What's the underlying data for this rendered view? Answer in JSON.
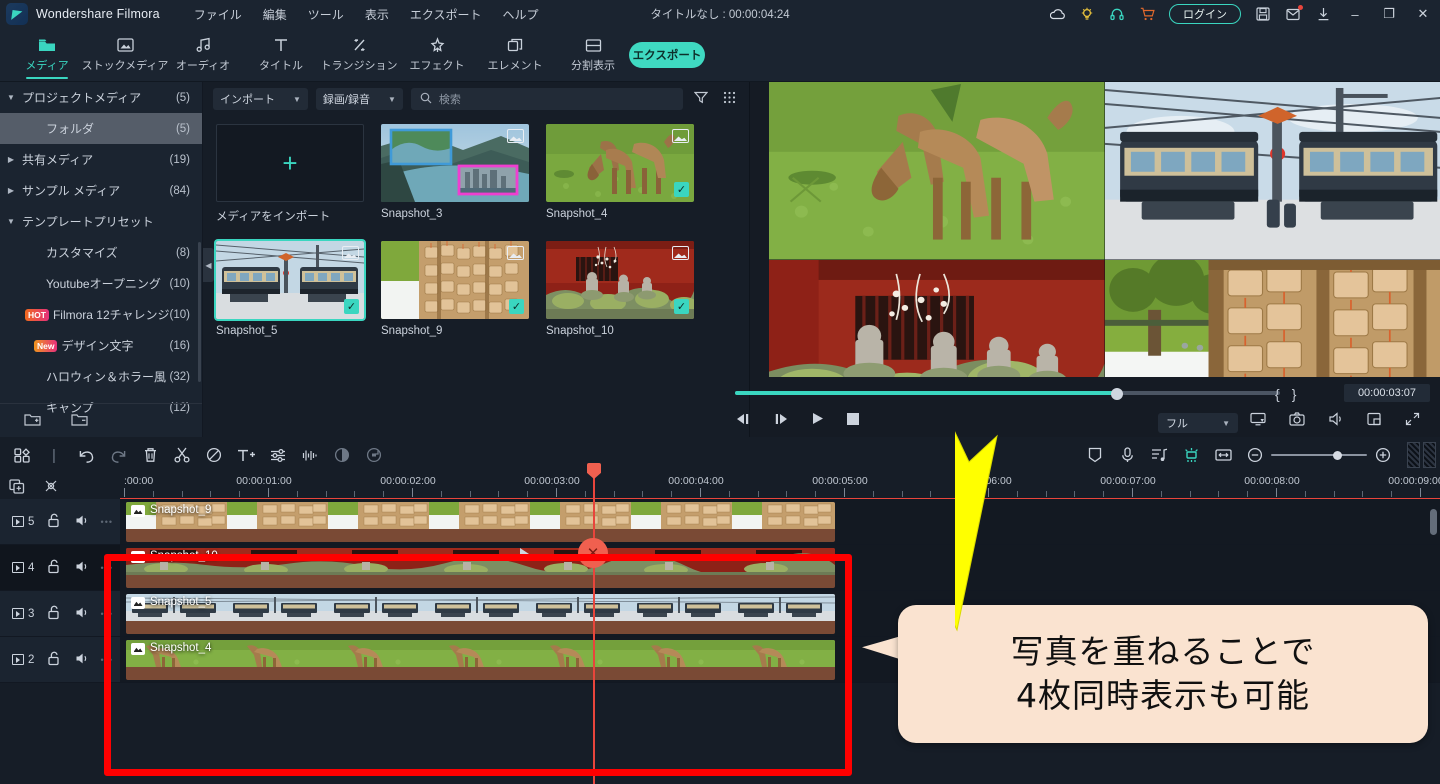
{
  "app": {
    "name": "Wondershare Filmora",
    "logo_icon": "filmora-logo-icon",
    "doc_title": "タイトルなし : 00:00:04:24"
  },
  "menu": [
    "ファイル",
    "編集",
    "ツール",
    "表示",
    "エクスポート",
    "ヘルプ"
  ],
  "titlebar_icons": [
    {
      "name": "cloud-icon",
      "glyph": "☁",
      "color": "#d8dee6"
    },
    {
      "name": "lightbulb-icon",
      "glyph": "💡",
      "color": "#e7c13c"
    },
    {
      "name": "headset-icon",
      "glyph": "🎧",
      "color": "#3ad6c0"
    },
    {
      "name": "cart-icon",
      "glyph": "🛒",
      "color": "#e2692c"
    }
  ],
  "login_label": "ログイン",
  "window_icons": [
    {
      "name": "save-icon",
      "glyph": "▤"
    },
    {
      "name": "mail-icon",
      "glyph": "✉"
    },
    {
      "name": "download-icon",
      "glyph": "⤓"
    }
  ],
  "window_controls": [
    "–",
    "❐",
    "✕"
  ],
  "navtabs": [
    {
      "label": "メディア",
      "icon": "folder-icon",
      "glyph": "▬",
      "active": true
    },
    {
      "label": "ストックメディア",
      "icon": "stock-media-icon",
      "glyph": "▣",
      "active": false
    },
    {
      "label": "オーディオ",
      "icon": "audio-note-icon",
      "glyph": "♬",
      "active": false
    },
    {
      "label": "タイトル",
      "icon": "title-text-icon",
      "glyph": "T",
      "active": false
    },
    {
      "label": "トランジション",
      "icon": "transition-icon",
      "glyph": "⇄",
      "active": false
    },
    {
      "label": "エフェクト",
      "icon": "effect-icon",
      "glyph": "✧",
      "active": false
    },
    {
      "label": "エレメント",
      "icon": "element-icon",
      "glyph": "❐",
      "active": false
    },
    {
      "label": "分割表示",
      "icon": "split-screen-icon",
      "glyph": "▤",
      "active": false
    }
  ],
  "export_label": "エクスポート",
  "sidebar": {
    "items": [
      {
        "label": "プロジェクトメディア",
        "count": "(5)",
        "arrow": "▼",
        "indent": 0,
        "selected": false,
        "tag": ""
      },
      {
        "label": "フォルダ",
        "count": "(5)",
        "arrow": "",
        "indent": 1,
        "selected": true,
        "tag": ""
      },
      {
        "label": "共有メディア",
        "count": "(19)",
        "arrow": "▶",
        "indent": 0,
        "selected": false,
        "tag": ""
      },
      {
        "label": "サンプル メディア",
        "count": "(84)",
        "arrow": "▶",
        "indent": 0,
        "selected": false,
        "tag": ""
      },
      {
        "label": "テンプレートプリセット",
        "count": "",
        "arrow": "▼",
        "indent": 0,
        "selected": false,
        "tag": ""
      },
      {
        "label": "カスタマイズ",
        "count": "(8)",
        "arrow": "",
        "indent": 1,
        "selected": false,
        "tag": ""
      },
      {
        "label": "Youtubeオープニング",
        "count": "(10)",
        "arrow": "",
        "indent": 1,
        "selected": false,
        "tag": ""
      },
      {
        "label": "Filmora 12チャレンジ",
        "count": "(10)",
        "arrow": "",
        "indent": 1,
        "selected": false,
        "tag": "HOT"
      },
      {
        "label": "デザイン文字",
        "count": "(16)",
        "arrow": "",
        "indent": 1,
        "selected": false,
        "tag": "New"
      },
      {
        "label": "ハロウィン＆ホラー風",
        "count": "(32)",
        "arrow": "",
        "indent": 1,
        "selected": false,
        "tag": ""
      },
      {
        "label": "キャンプ",
        "count": "(12)",
        "arrow": "",
        "indent": 1,
        "selected": false,
        "tag": ""
      }
    ],
    "footer_icons": [
      {
        "name": "new-folder-icon",
        "glyph": "🗀"
      },
      {
        "name": "remove-folder-icon",
        "glyph": "🗁"
      }
    ]
  },
  "media_panel": {
    "import_label": "インポート",
    "record_label": "録画/録音",
    "search_placeholder": "検索",
    "filter_icon": "filter-icon",
    "view_icon": "grid-view-icon",
    "import_tile_label": "メディアをインポート",
    "items": [
      {
        "label": "Snapshot_3",
        "checked": false,
        "selected": false
      },
      {
        "label": "Snapshot_4",
        "checked": true,
        "selected": false
      },
      {
        "label": "Snapshot_5",
        "checked": true,
        "selected": true
      },
      {
        "label": "Snapshot_9",
        "checked": true,
        "selected": false
      },
      {
        "label": "Snapshot_10",
        "checked": true,
        "selected": false
      }
    ]
  },
  "preview": {
    "timecode": "00:00:03:07",
    "mark_in": "{",
    "mark_out": "}",
    "quality_label": "フル",
    "progress_percent": 70,
    "transport": [
      {
        "name": "prev-frame-button",
        "glyph": "◀|"
      },
      {
        "name": "next-frame-button",
        "glyph": "|▶"
      },
      {
        "name": "play-button",
        "glyph": "▶"
      },
      {
        "name": "stop-button",
        "glyph": "■"
      }
    ],
    "right_icons": [
      {
        "name": "screen-cast-icon",
        "glyph": "🖵"
      },
      {
        "name": "snapshot-camera-icon",
        "glyph": "📷"
      },
      {
        "name": "volume-icon",
        "glyph": "🔊"
      },
      {
        "name": "pip-icon",
        "glyph": "❐"
      },
      {
        "name": "fullscreen-icon",
        "glyph": "⤢"
      }
    ]
  },
  "timeline": {
    "tools_left": [
      {
        "name": "layout-grid-icon",
        "glyph": "⠿",
        "state": "normal"
      },
      {
        "name": "divider",
        "glyph": "|",
        "state": "dim"
      },
      {
        "name": "undo-icon",
        "glyph": "↺",
        "state": "normal"
      },
      {
        "name": "redo-icon",
        "glyph": "↻",
        "state": "dim"
      },
      {
        "name": "delete-icon",
        "glyph": "🗑",
        "state": "normal"
      },
      {
        "name": "cut-scissors-icon",
        "glyph": "✂",
        "state": "normal"
      },
      {
        "name": "disable-icon",
        "glyph": "⊘",
        "state": "normal"
      },
      {
        "name": "add-text-icon",
        "glyph": "T+",
        "state": "normal"
      },
      {
        "name": "adjust-sliders-icon",
        "glyph": "⇌",
        "state": "normal"
      },
      {
        "name": "audio-wave-icon",
        "glyph": "⑊",
        "state": "normal"
      },
      {
        "name": "color-match-icon",
        "glyph": "◑",
        "state": "dim"
      },
      {
        "name": "speed-icon",
        "glyph": "⟳",
        "state": "dim"
      }
    ],
    "tools_right": [
      {
        "name": "marker-icon",
        "glyph": "⌂",
        "state": "normal"
      },
      {
        "name": "voiceover-mic-icon",
        "glyph": "🎤",
        "state": "normal"
      },
      {
        "name": "beat-detect-icon",
        "glyph": "♪",
        "state": "normal"
      },
      {
        "name": "render-preview-icon",
        "glyph": "✳",
        "state": "green"
      },
      {
        "name": "fit-timeline-icon",
        "glyph": "↔",
        "state": "normal"
      },
      {
        "name": "zoom-out-icon",
        "glyph": "⊖",
        "state": "normal"
      }
    ],
    "zoom_in_icon": "zoom-in-icon",
    "row2_icons": [
      {
        "name": "add-track-icon",
        "glyph": "⎘"
      },
      {
        "name": "unlink-icon",
        "glyph": "⚯"
      }
    ],
    "ruler_labels": [
      ":00:00",
      "00:00:01:00",
      "00:00:02:00",
      "00:00:03:00",
      "00:00:04:00",
      "00:00:05:00",
      "00:00:06:00",
      "00:00:07:00",
      "00:00:08:00",
      "00:00:09:00"
    ],
    "playhead_time": "00:00:03:00",
    "tracks": [
      {
        "number": "5",
        "clip_label": "Snapshot_9",
        "lock_icon": "unlock-icon",
        "mute_icon": "speaker-icon"
      },
      {
        "number": "4",
        "clip_label": "Snapshot_10",
        "lock_icon": "unlock-icon",
        "mute_icon": "speaker-icon"
      },
      {
        "number": "3",
        "clip_label": "Snapshot_5",
        "lock_icon": "unlock-icon",
        "mute_icon": "speaker-icon"
      },
      {
        "number": "2",
        "clip_label": "Snapshot_4",
        "lock_icon": "unlock-icon",
        "mute_icon": "speaker-icon"
      }
    ]
  },
  "annotation": {
    "callout_line1": "写真を重ねることで",
    "callout_line2": "4枚同時表示も可能",
    "highlight_color": "#ff0000",
    "arrow_color": "#ffff00",
    "callout_bg": "#fae3d0"
  },
  "colors": {
    "accent": "#3ad6c0",
    "panel": "#1b2430",
    "canvas": "#161d27",
    "playhead": "#e8453c"
  }
}
